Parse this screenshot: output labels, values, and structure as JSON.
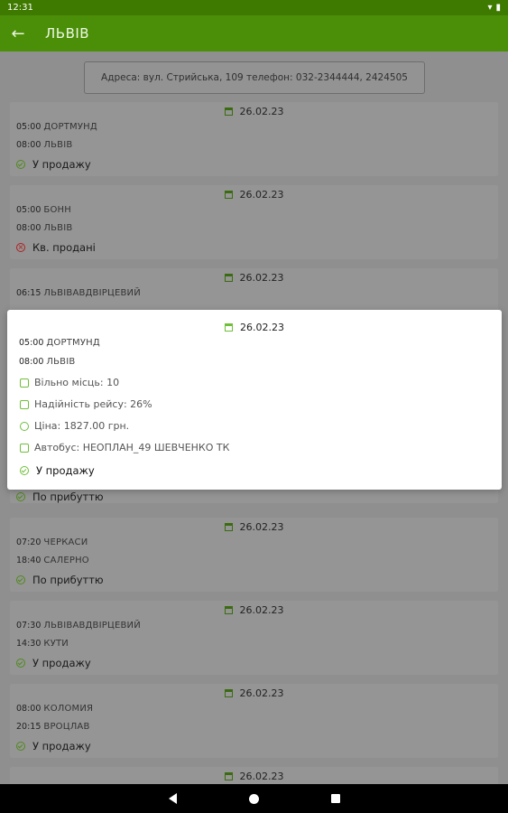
{
  "status_bar": {
    "time": "12:31"
  },
  "app_bar": {
    "title": "ЛЬВІВ"
  },
  "address": "Адреса: вул. Стрийська, 109 телефон: 032-2344444, 2424505",
  "trips": [
    {
      "date": "26.02.23",
      "dep_time": "05:00",
      "dep_city": "ДОРТМУНД",
      "arr_time": "08:00",
      "arr_city": "ЛЬВІВ",
      "status": "У продажу",
      "status_type": "ok"
    },
    {
      "date": "26.02.23",
      "dep_time": "05:00",
      "dep_city": "БОНН",
      "arr_time": "08:00",
      "arr_city": "ЛЬВІВ",
      "status": "Кв. продані",
      "status_type": "sold"
    },
    {
      "date": "26.02.23",
      "dep_time": "06:15",
      "dep_city": "ЛЬВІВАВДВІРЦЕВИЙ",
      "arr_time": "",
      "arr_city": "",
      "status": "По прибуттю",
      "status_type": "ok"
    },
    {
      "date": "26.02.23",
      "dep_time": "07:20",
      "dep_city": "ЧЕРКАСИ",
      "arr_time": "18:40",
      "arr_city": "САЛЕРНО",
      "status": "По прибуттю",
      "status_type": "ok"
    },
    {
      "date": "26.02.23",
      "dep_time": "07:30",
      "dep_city": "ЛЬВІВАВДВІРЦЕВИЙ",
      "arr_time": "14:30",
      "arr_city": "КУТИ",
      "status": "У продажу",
      "status_type": "ok"
    },
    {
      "date": "26.02.23",
      "dep_time": "08:00",
      "dep_city": "КОЛОМИЯ",
      "arr_time": "20:15",
      "arr_city": "ВРОЦЛАВ",
      "status": "У продажу",
      "status_type": "ok"
    },
    {
      "date": "26.02.23"
    }
  ],
  "popup": {
    "date": "26.02.23",
    "dep_time": "05:00",
    "dep_city": "ДОРТМУНД",
    "arr_time": "08:00",
    "arr_city": "ЛЬВІВ",
    "free_seats": "Вільно місць: 10",
    "reliability": "Надійність рейсу: 26%",
    "price": "Ціна: 1827.00 грн.",
    "bus": "Автобус: НЕОПЛАН_49 ШЕВЧЕНКО ТК",
    "status": "У продажу"
  },
  "colors": {
    "accent": "#4b8f08",
    "status_bar": "#3e7a00",
    "ok": "#6fbf3a",
    "sold": "#b02020"
  },
  "icons": [
    "back-arrow-icon",
    "calendar-icon",
    "check-circle-icon",
    "cancel-circle-icon",
    "seat-icon",
    "reliability-icon",
    "price-icon",
    "bus-icon",
    "wifi-icon",
    "battery-icon"
  ]
}
